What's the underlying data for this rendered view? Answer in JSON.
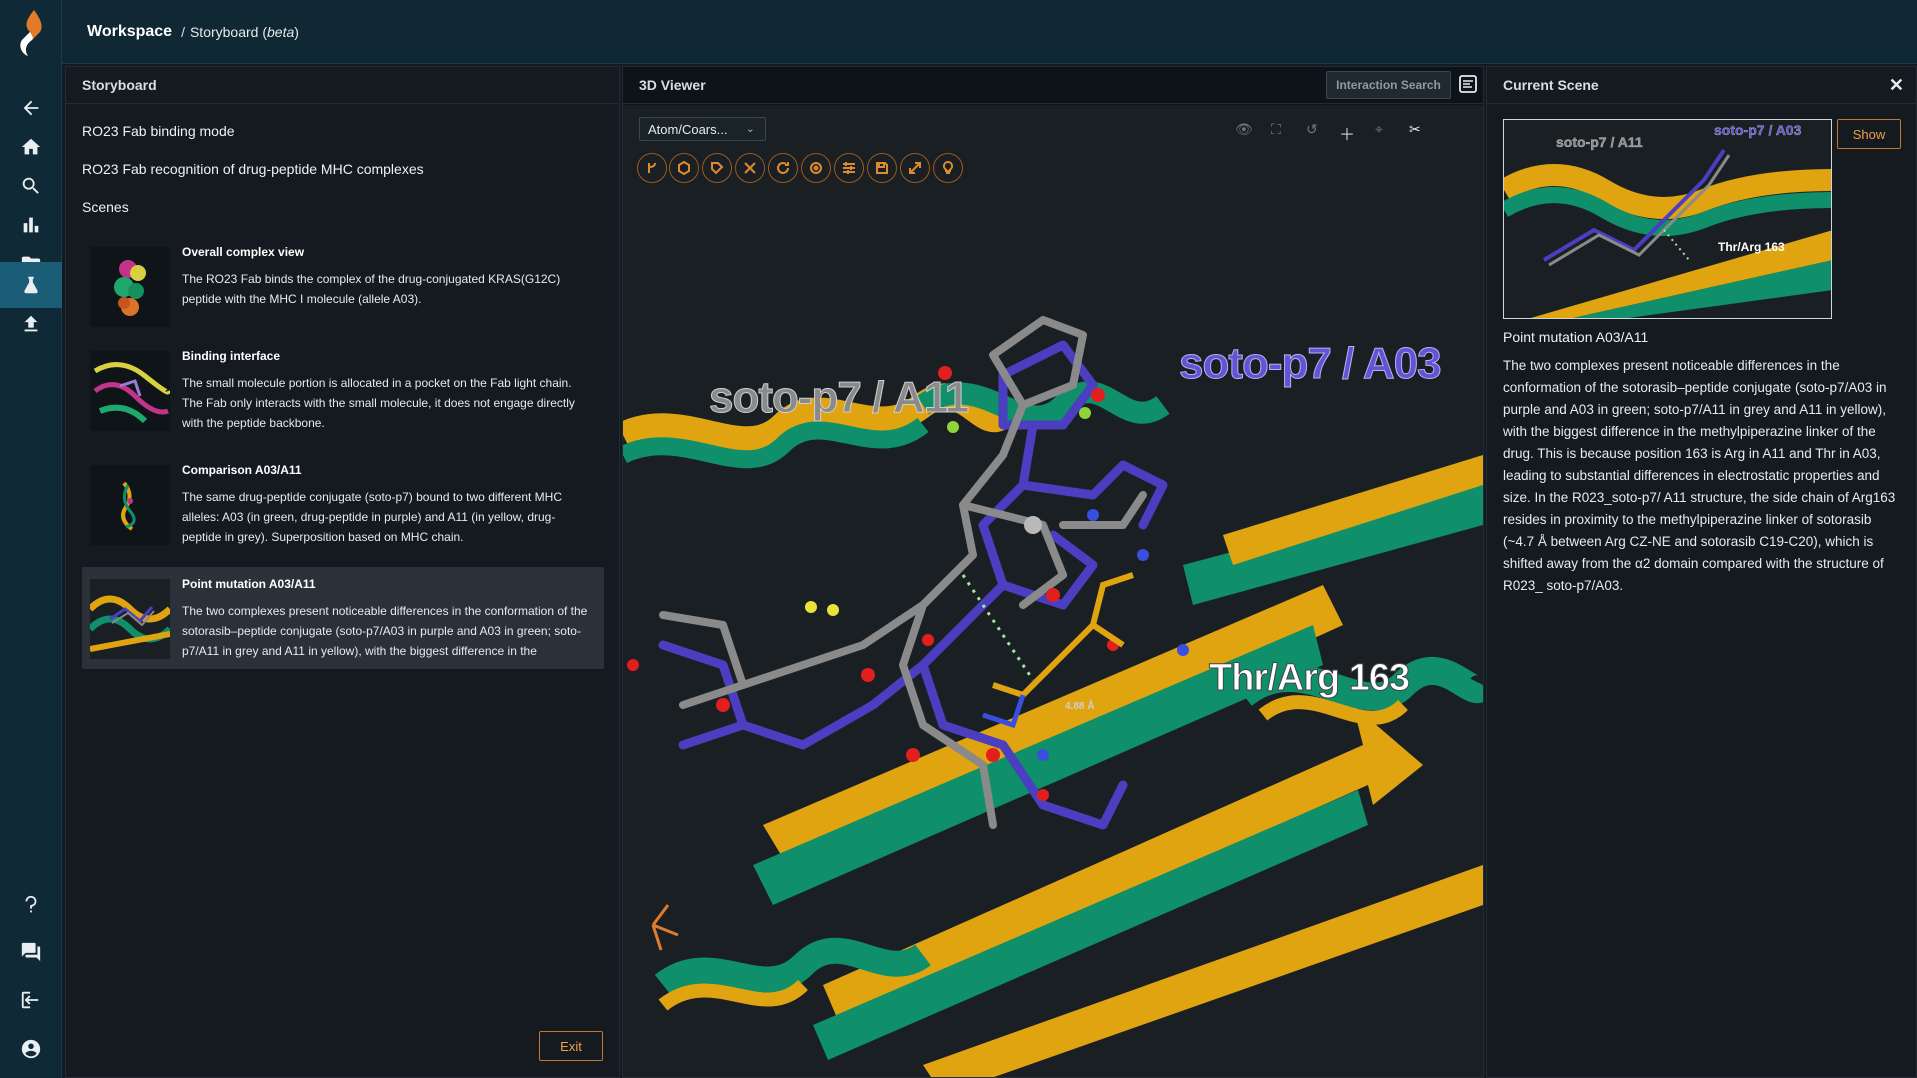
{
  "topbar": {
    "root": "Workspace",
    "separator": "/",
    "current": "Storyboard",
    "current_tag": "beta"
  },
  "rail": {
    "icons": [
      "back-arrow-icon",
      "home-icon",
      "search-icon",
      "bar-chart-icon",
      "folder-icon",
      "flask-icon",
      "upload-icon",
      "help-icon",
      "chat-icon",
      "logout-icon",
      "user-icon"
    ]
  },
  "storyboard": {
    "header": "Storyboard",
    "title": "RO23 Fab binding mode",
    "subtitle": "RO23 Fab recognition of drug-peptide MHC complexes",
    "scenes_label": "Scenes",
    "scenes": [
      {
        "title": "Overall complex view",
        "text": "The RO23 Fab binds the complex of the drug-conjugated KRAS(G12C) peptide with the MHC I molecule (allele A03)."
      },
      {
        "title": "Binding interface",
        "text": "The small molecule portion is allocated in a pocket on the Fab light chain. The Fab only interacts with the small molecule, it does not engage directly with the peptide backbone."
      },
      {
        "title": "Comparison A03/A11",
        "text": "The same drug-peptide conjugate (soto-p7) bound to two different MHC alleles: A03 (in green, drug-peptide in purple) and A11 (in yellow, drug-peptide in grey). Superposition based on MHC chain."
      },
      {
        "title": "Point mutation A03/A11",
        "text": "The two complexes present noticeable differences in the conformation of the sotorasib–peptide conjugate (soto-p7/A03 in purple and A03 in green; soto-p7/A11 in grey and A11 in yellow), with the biggest difference in the"
      }
    ],
    "exit_label": "Exit"
  },
  "viewer": {
    "header": "3D Viewer",
    "interaction_search": "Interaction Search",
    "representation": "Atom/Coars...",
    "labels": {
      "a11": "soto-p7 / A11",
      "a03": "soto-p7 / A03",
      "residue": "Thr/Arg 163",
      "distance": "4.88 Å"
    },
    "colors": {
      "green": "#0f8f6a",
      "yellow": "#e0a411",
      "purple": "#4b3ec0",
      "grey": "#8a8a8a",
      "accent": "#e08a2e"
    }
  },
  "current_scene": {
    "header": "Current Scene",
    "show_label": "Show",
    "preview_labels": {
      "a11": "soto-p7 / A11",
      "a03": "soto-p7 / A03",
      "residue": "Thr/Arg 163"
    },
    "title": "Point mutation A03/A11",
    "text": "The two complexes present noticeable differences in the conformation of the sotorasib–peptide conjugate (soto-p7/A03 in purple and A03 in green; soto-p7/A11 in grey and A11 in yellow), with the biggest difference in the methylpiperazine linker of the drug. This is because position 163 is Arg in A11 and Thr in A03, leading to substantial differences in electrostatic properties and size. In the R023_soto-p7/ A11 structure, the side chain of Arg163 resides in proximity to the methylpiperazine linker of sotorasib (~4.7 Å between Arg CZ-NE and sotorasib C19-C20), which is shifted away from the α2 domain compared with the structure of R023_ soto-p7/A03."
  }
}
